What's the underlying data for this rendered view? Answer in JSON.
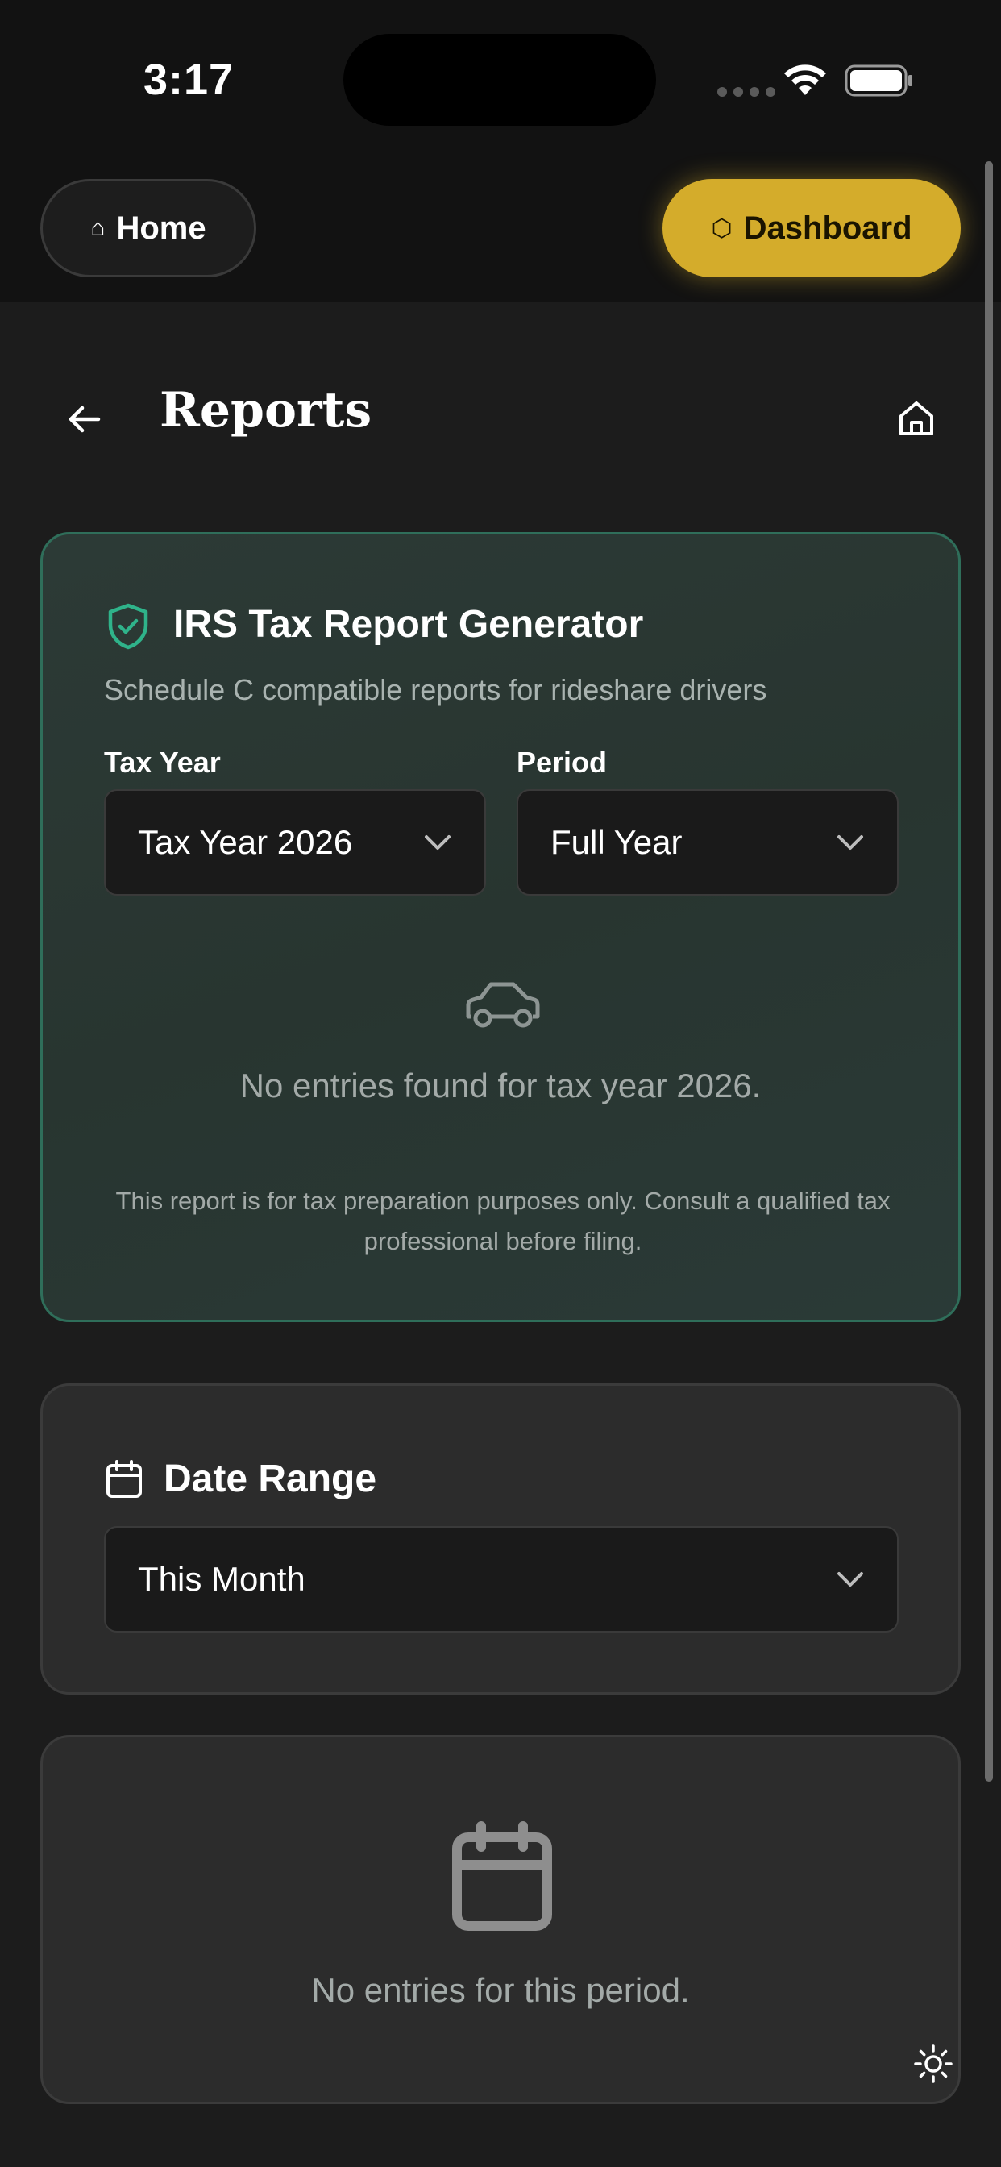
{
  "status_bar": {
    "time": "3:17"
  },
  "nav": {
    "home_label": "Home",
    "dashboard_label": "Dashboard",
    "home_glyph": "⌂",
    "dashboard_glyph": "⬡"
  },
  "header": {
    "title": "Reports"
  },
  "tax_report": {
    "title": "IRS Tax Report Generator",
    "subtitle": "Schedule C compatible reports for rideshare drivers",
    "tax_year_label": "Tax Year",
    "tax_year_value": "Tax Year 2026",
    "period_label": "Period",
    "period_value": "Full Year",
    "empty_message": "No entries found for tax year 2026.",
    "disclaimer": "This report is for tax preparation purposes only. Consult a qualified tax professional before filing."
  },
  "date_range": {
    "title": "Date Range",
    "selected": "This Month"
  },
  "entries": {
    "empty_message": "No entries for this period."
  },
  "colors": {
    "accent_gold": "#d4ac2b",
    "accent_green": "#2fb38a",
    "background": "#1c1c1c",
    "card": "#2c2c2c"
  },
  "icons": [
    "back-arrow-icon",
    "house-icon",
    "shield-check-icon",
    "chevron-down-icon",
    "car-icon",
    "calendar-icon",
    "sun-icon",
    "wifi-icon",
    "battery-icon"
  ]
}
